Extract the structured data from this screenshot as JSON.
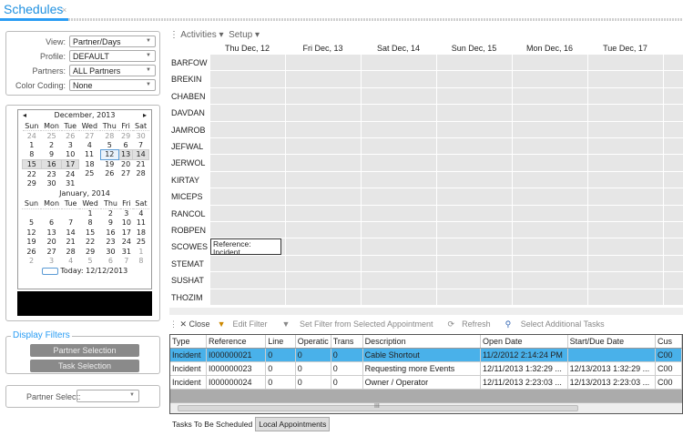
{
  "tab": {
    "title": "Schedules",
    "close": "×"
  },
  "filters": {
    "view_label": "View:",
    "view": "Partner/Days",
    "profile_label": "Profile:",
    "profile": "DEFAULT",
    "partners_label": "Partners:",
    "partners": "ALL Partners",
    "color_label": "Color Coding:",
    "color": "None"
  },
  "calendar": {
    "dow": [
      "Sun",
      "Mon",
      "Tue",
      "Wed",
      "Thu",
      "Fri",
      "Sat"
    ],
    "months": [
      {
        "title": "December, 2013",
        "days": [
          [
            "24",
            "25",
            "26",
            "27",
            "28",
            "29",
            "30"
          ],
          [
            "1",
            "2",
            "3",
            "4",
            "5",
            "6",
            "7"
          ],
          [
            "8",
            "9",
            "10",
            "11",
            "12",
            "13",
            "14"
          ],
          [
            "15",
            "16",
            "17",
            "18",
            "19",
            "20",
            "21"
          ],
          [
            "22",
            "23",
            "24",
            "25",
            "26",
            "27",
            "28"
          ],
          [
            "29",
            "30",
            "31",
            "",
            "",
            "",
            ""
          ]
        ]
      },
      {
        "title": "January, 2014",
        "days": [
          [
            "",
            "",
            "",
            "1",
            "2",
            "3",
            "4"
          ],
          [
            "5",
            "6",
            "7",
            "8",
            "9",
            "10",
            "11"
          ],
          [
            "12",
            "13",
            "14",
            "15",
            "16",
            "17",
            "18"
          ],
          [
            "19",
            "20",
            "21",
            "22",
            "23",
            "24",
            "25"
          ],
          [
            "26",
            "27",
            "28",
            "29",
            "30",
            "31",
            "1"
          ],
          [
            "2",
            "3",
            "4",
            "5",
            "6",
            "7",
            "8"
          ]
        ]
      }
    ],
    "today": "Today: 12/12/2013",
    "prev": "◂",
    "next": "▸"
  },
  "display_filters": {
    "title": "Display Filters",
    "partner_btn": "Partner Selection",
    "task_btn": "Task Selection"
  },
  "partner_select": {
    "label": "Partner Select:",
    "value": ""
  },
  "scheduler": {
    "activities": "Activities ▾",
    "setup": "Setup ▾",
    "days": [
      "Thu Dec, 12",
      "Fri Dec, 13",
      "Sat Dec, 14",
      "Sun Dec, 15",
      "Mon Dec, 16",
      "Tue Dec, 17"
    ],
    "partners": [
      "BARFOW",
      "BREKIN",
      "CHABEN",
      "DAVDAN",
      "JAMROB",
      "JEFWAL",
      "JERWOL",
      "KIRTAY",
      "MICEPS",
      "RANCOL",
      "ROBPEN",
      "SCOWES",
      "STEMAT",
      "SUSHAT",
      "THOZIM"
    ],
    "appointment": {
      "text": "Reference: Incident"
    }
  },
  "task_toolbar": {
    "close": "✕ Close",
    "edit": "Edit Filter",
    "setfilter": "Set Filter from Selected Appointment",
    "refresh": "Refresh",
    "select": "Select Additional Tasks"
  },
  "tasks": {
    "columns": [
      "Type",
      "Reference",
      "Line",
      "Operatic",
      "Trans",
      "Description",
      "Open Date",
      "Start/Due Date",
      "Cus"
    ],
    "rows": [
      [
        "Incident",
        "I000000021",
        "0",
        "0",
        "0",
        "Cable Shortout",
        "11/2/2012 2:14:24 PM",
        "",
        "C00"
      ],
      [
        "Incident",
        "I000000023",
        "0",
        "0",
        "0",
        "Requesting more Events",
        "12/11/2013 1:32:29 ...",
        "12/13/2013 1:32:29 ...",
        "C00"
      ],
      [
        "Incident",
        "I000000024",
        "0",
        "0",
        "0",
        "Owner / Operator",
        "12/11/2013 2:23:03 ...",
        "12/13/2013 2:23:03 ...",
        "C00"
      ]
    ],
    "scroll_grip": "III"
  },
  "bottom_tabs": [
    "Tasks To Be Scheduled",
    "Local Appointments"
  ]
}
